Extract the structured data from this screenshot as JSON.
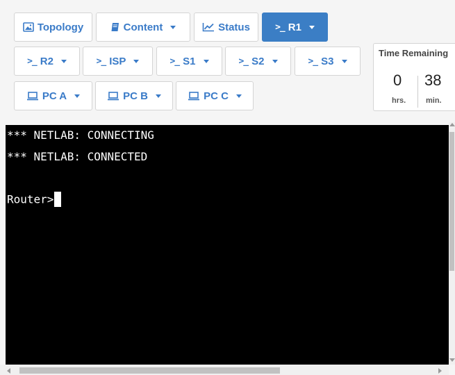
{
  "toolbar": {
    "row1": [
      {
        "label": "Topology",
        "icon": "image-icon",
        "dropdown": false,
        "active": false
      },
      {
        "label": "Content",
        "icon": "book-icon",
        "dropdown": true,
        "active": false
      },
      {
        "label": "Status",
        "icon": "chart-line-icon",
        "dropdown": false,
        "active": false
      },
      {
        "label": "R1",
        "icon": "terminal-prompt-icon",
        "dropdown": true,
        "active": true
      }
    ],
    "row2": [
      {
        "label": "R2",
        "icon": "terminal-prompt-icon",
        "dropdown": true
      },
      {
        "label": "ISP",
        "icon": "terminal-prompt-icon",
        "dropdown": true
      },
      {
        "label": "S1",
        "icon": "terminal-prompt-icon",
        "dropdown": true
      },
      {
        "label": "S2",
        "icon": "terminal-prompt-icon",
        "dropdown": true
      },
      {
        "label": "S3",
        "icon": "terminal-prompt-icon",
        "dropdown": true
      }
    ],
    "row3": [
      {
        "label": "PC A",
        "icon": "laptop-icon",
        "dropdown": true
      },
      {
        "label": "PC B",
        "icon": "laptop-icon",
        "dropdown": true
      },
      {
        "label": "PC C",
        "icon": "laptop-icon",
        "dropdown": true
      }
    ],
    "prompt_glyph": ">_"
  },
  "timer": {
    "title": "Time Remaining",
    "hours": "0",
    "hours_unit": "hrs.",
    "minutes": "38",
    "minutes_unit": "min."
  },
  "terminal": {
    "lines": [
      "*** NETLAB: CONNECTING",
      "*** NETLAB: CONNECTED",
      "",
      "Router>"
    ]
  },
  "colors": {
    "accent": "#3b7ec5",
    "button_text": "#3a7bc8",
    "terminal_bg": "#000000",
    "terminal_fg": "#ffffff"
  }
}
